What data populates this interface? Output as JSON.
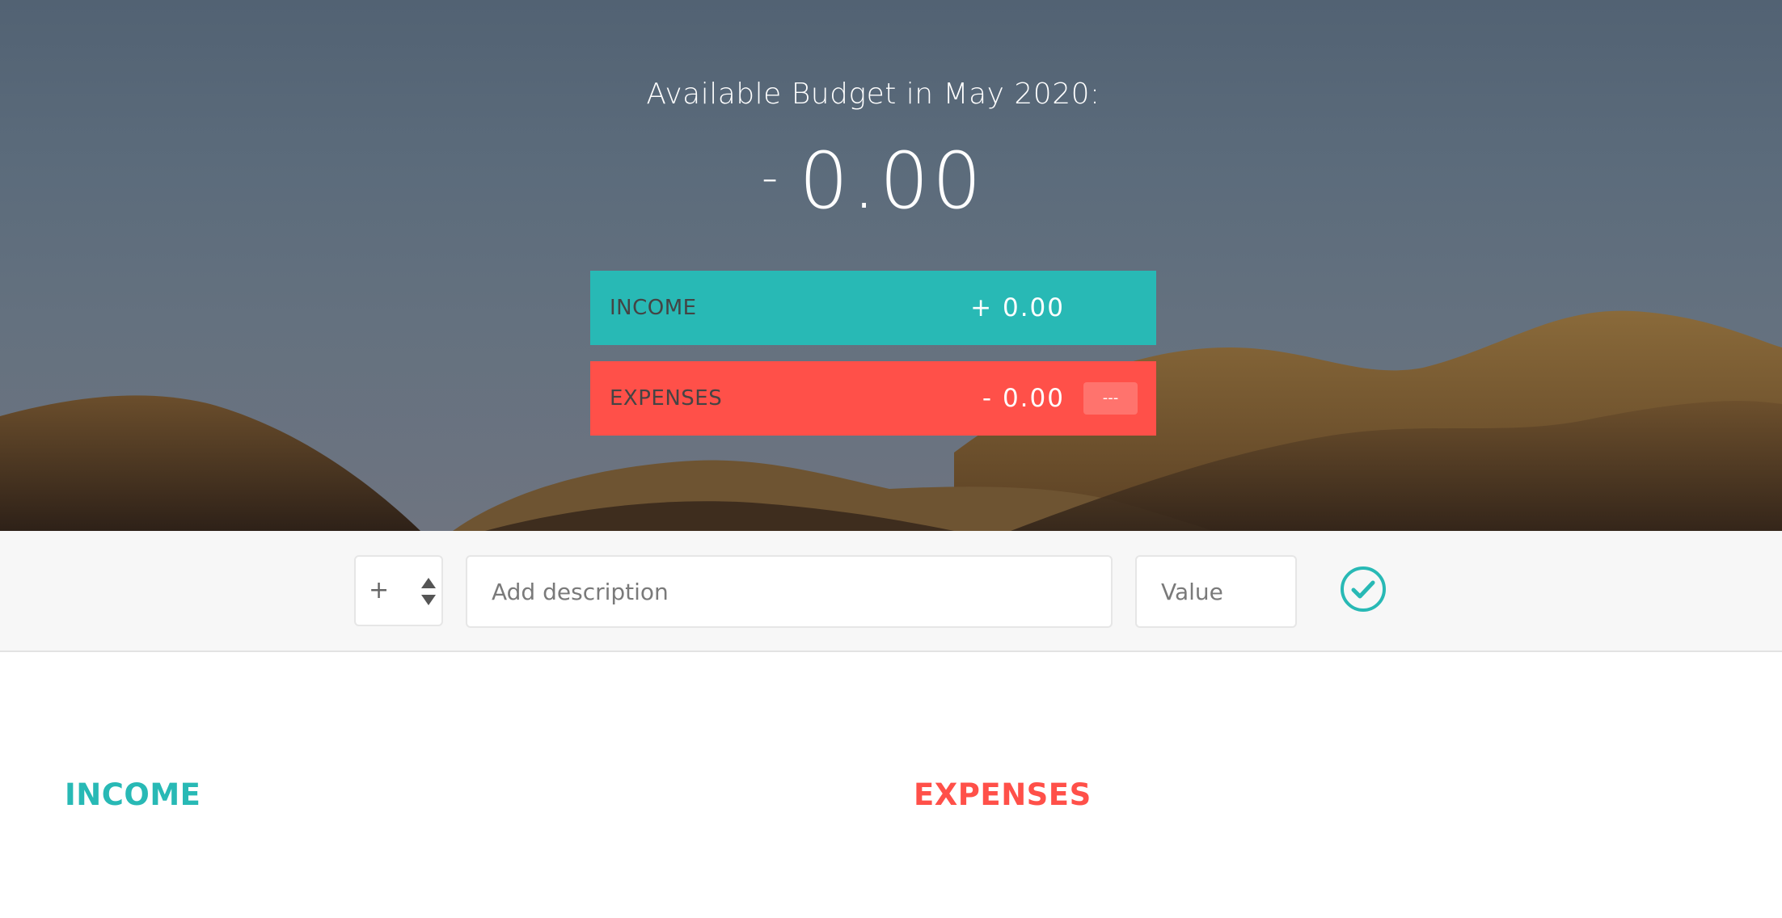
{
  "budget": {
    "title": "Available Budget in May 2020:",
    "sign": "-",
    "value": "0.00"
  },
  "summary": {
    "income": {
      "label": "INCOME",
      "amount": "+ 0.00"
    },
    "expenses": {
      "label": "EXPENSES",
      "amount": "- 0.00",
      "percentage": "---"
    }
  },
  "add_form": {
    "type_value": "+",
    "description_placeholder": "Add description",
    "value_placeholder": "Value",
    "submit_icon": "check-circle-icon"
  },
  "lists": {
    "income_title": "INCOME",
    "expenses_title": "EXPENSES"
  },
  "colors": {
    "income": "#28b9b5",
    "expenses": "#ff5049"
  }
}
